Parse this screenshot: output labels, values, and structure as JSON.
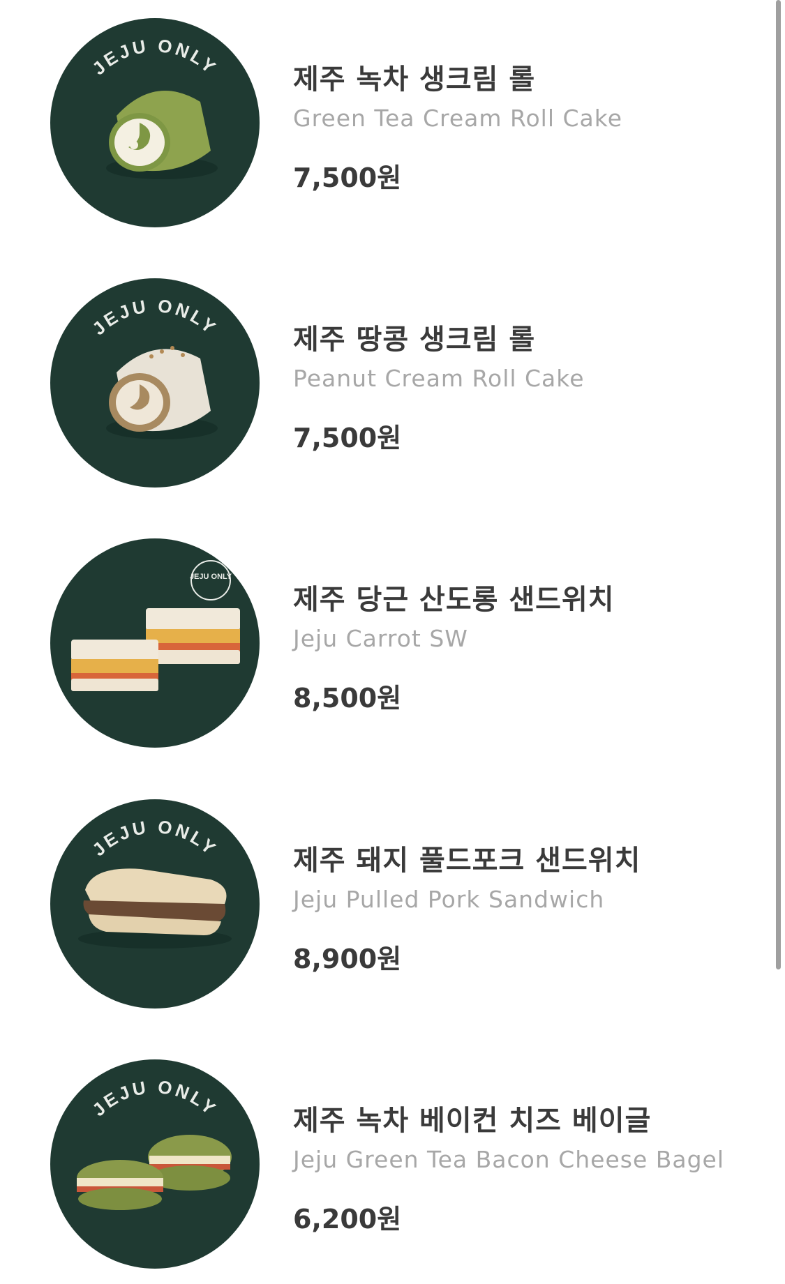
{
  "menu_items": [
    {
      "name_ko": "제주 녹차 생크림 롤",
      "name_en": "Green Tea Cream Roll Cake",
      "price": "7,500원",
      "badge": "JEJU ONLY"
    },
    {
      "name_ko": "제주 땅콩 생크림 롤",
      "name_en": "Peanut Cream Roll Cake",
      "price": "7,500원",
      "badge": "JEJU ONLY"
    },
    {
      "name_ko": "제주 당근 산도롱 샌드위치",
      "name_en": "Jeju Carrot SW",
      "price": "8,500원",
      "badge": "JEJU ONLY"
    },
    {
      "name_ko": "제주 돼지 풀드포크 샌드위치",
      "name_en": "Jeju Pulled Pork Sandwich",
      "price": "8,900원",
      "badge": "JEJU ONLY"
    },
    {
      "name_ko": "제주 녹차 베이컨 치즈 베이글",
      "name_en": "Jeju Green Tea Bacon Cheese Bagel",
      "price": "6,200원",
      "badge": "JEJU ONLY"
    }
  ],
  "colors": {
    "thumb_bg": "#1f3a32",
    "title_text": "#3a3a3a",
    "subtitle_text": "#a7a7a7"
  }
}
